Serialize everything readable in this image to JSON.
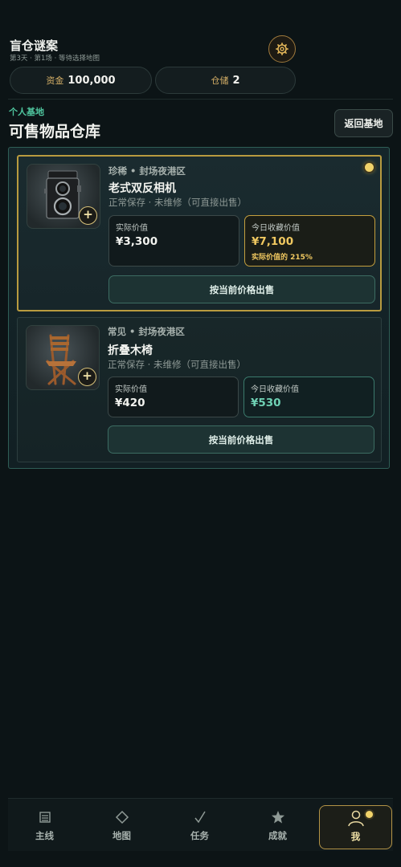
{
  "header": {
    "title": "盲仓谜案",
    "subtitle": "第3天 · 第1场 · 等待选择地图"
  },
  "resources": {
    "funds_label": "资金",
    "funds_value": "100,000",
    "storage_label": "仓储",
    "storage_value": "2"
  },
  "page": {
    "kicker": "个人基地",
    "title": "可售物品仓库",
    "back_label": "返回基地"
  },
  "items": [
    {
      "meta": "珍稀 • 封场夜港区",
      "name": "老式双反相机",
      "condition": "正常保存 · 未维修（可直接出售）",
      "real_label": "实际价值",
      "real_value": "¥3,300",
      "today_label": "今日收藏价值",
      "today_value": "¥7,100",
      "today_note": "实际价值的 215%",
      "sell_label": "按当前价格出售",
      "image_icon": "camera-icon"
    },
    {
      "meta": "常见 • 封场夜港区",
      "name": "折叠木椅",
      "condition": "正常保存 · 未维修（可直接出售）",
      "real_label": "实际价值",
      "real_value": "¥420",
      "today_label": "今日收藏价值",
      "today_value": "¥530",
      "sell_label": "按当前价格出售",
      "image_icon": "chair-icon"
    }
  ],
  "nav": [
    {
      "label": "主线",
      "icon": "list-icon"
    },
    {
      "label": "地图",
      "icon": "diamond-icon"
    },
    {
      "label": "任务",
      "icon": "check-icon"
    },
    {
      "label": "成就",
      "icon": "star-icon"
    },
    {
      "label": "我",
      "icon": "person-icon",
      "active": true
    }
  ],
  "colors": {
    "accent_gold": "#f0c860",
    "accent_teal": "#4fc59e",
    "background": "#0c1416"
  }
}
